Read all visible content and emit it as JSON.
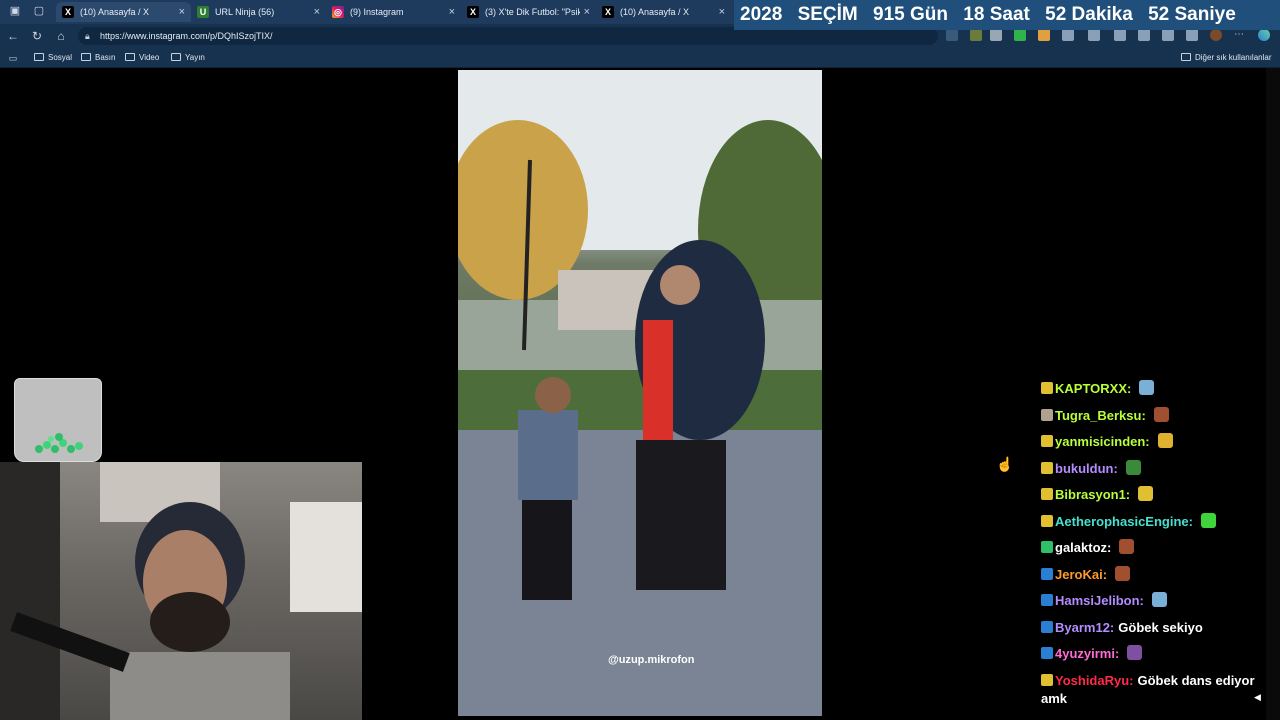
{
  "tabs": [
    {
      "title": "(10) Anasayfa / X",
      "favicon": "x-logo-icon",
      "active": true
    },
    {
      "title": "URL Ninja (56)",
      "favicon": "ninja-icon",
      "active": false
    },
    {
      "title": "(9) Instagram",
      "favicon": "instagram-icon",
      "active": false
    },
    {
      "title": "(3) X'te Dik Futbol: \"Psikol",
      "favicon": "x-logo-icon",
      "active": false
    },
    {
      "title": "(10) Anasayfa / X",
      "favicon": "x-logo-icon",
      "active": false
    }
  ],
  "countdown": {
    "year": "2028",
    "label": "SEÇİM",
    "days": "915 Gün",
    "hours": "18 Saat",
    "minutes": "52 Dakika",
    "seconds": "52 Saniye"
  },
  "address": {
    "url": "https://www.instagram.com/p/DQhISzojTIX/"
  },
  "bookmarks": {
    "items": [
      "Sosyal",
      "Basın",
      "Video",
      "Yayın"
    ],
    "other": "Diğer sık kullanılanlar"
  },
  "video": {
    "watermark": "@uzup.mikrofon"
  },
  "chat": [
    {
      "user": "KAPTORXX:",
      "text": "",
      "color": "#b9ff3a"
    },
    {
      "user": "Tugra_Berksu:",
      "text": "",
      "color": "#b9ff3a"
    },
    {
      "user": "yanmisicinden:",
      "text": "",
      "color": "#b9ff3a"
    },
    {
      "user": "bukuldun:",
      "text": "",
      "color": "#b38cff"
    },
    {
      "user": "Bibrasyon1:",
      "text": "",
      "color": "#b9ff3a"
    },
    {
      "user": "AetherophasicEngine:",
      "text": "",
      "color": "#46e0d0"
    },
    {
      "user": "galaktoz:",
      "text": "",
      "color": "#ffffff"
    },
    {
      "user": "JeroKai:",
      "text": "",
      "color": "#ff9a2e"
    },
    {
      "user": "HamsiJelibon:",
      "text": "",
      "color": "#b38cff"
    },
    {
      "user": "Byarm12:",
      "text": "Göbek sekiyo",
      "color": "#b38cff"
    },
    {
      "user": "4yuzyirmi:",
      "text": "",
      "color": "#ff6ad5"
    },
    {
      "user": "YoshidaRyu:",
      "text": "Göbek dans ediyor amk",
      "color": "#ff2a4a"
    }
  ]
}
